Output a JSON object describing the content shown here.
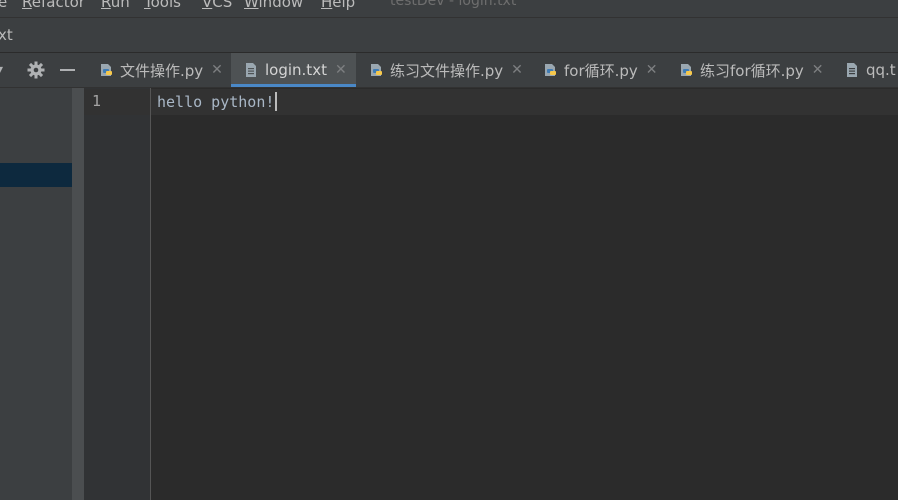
{
  "menubar": {
    "items": [
      {
        "label": "e",
        "mnemonic": ""
      },
      {
        "label": "efactor",
        "mnemonic": "R"
      },
      {
        "label": "un",
        "mnemonic": "R"
      },
      {
        "label": "ools",
        "mnemonic": "T"
      },
      {
        "label": "CS",
        "mnemonic": "V"
      },
      {
        "label": "indow",
        "mnemonic": "W"
      },
      {
        "label": "elp",
        "mnemonic": "H"
      }
    ],
    "title": "testDev - login.txt"
  },
  "navbar": {
    "crumb": "xt"
  },
  "panel": {
    "chevron": "▾"
  },
  "tabs": [
    {
      "label": "文件操作.py",
      "icon": "python-file-icon",
      "active": false
    },
    {
      "label": "login.txt",
      "icon": "text-file-icon",
      "active": true
    },
    {
      "label": "练习文件操作.py",
      "icon": "python-file-icon",
      "active": false
    },
    {
      "label": "for循环.py",
      "icon": "python-file-icon",
      "active": false
    },
    {
      "label": "练习for循环.py",
      "icon": "python-file-icon",
      "active": false
    },
    {
      "label": "qq.t",
      "icon": "text-file-icon",
      "active": false
    }
  ],
  "tab_close_glyph": "✕",
  "editor": {
    "line_numbers": [
      "1"
    ],
    "lines": [
      "hello python!"
    ]
  },
  "colors": {
    "background": "#2b2b2b",
    "panel": "#3c3f41",
    "accent": "#4a88c7",
    "text": "#a9b7c6"
  }
}
